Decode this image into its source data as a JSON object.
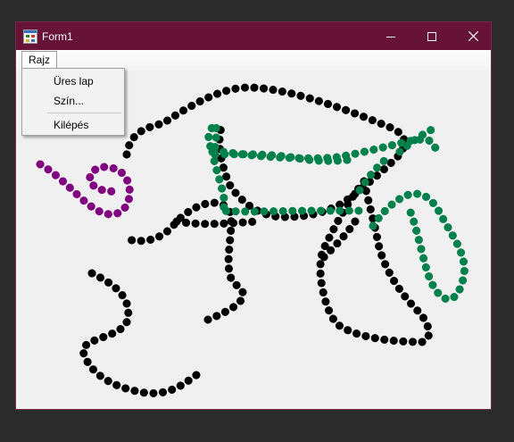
{
  "window": {
    "title": "Form1",
    "titlebar_color": "#661337"
  },
  "menu": {
    "label": "Rajz",
    "items": [
      "Üres lap",
      "Szín...",
      "Kilépés"
    ]
  },
  "icons": {
    "app": "app-form-icon",
    "minimize": "minimize-icon",
    "maximize": "maximize-icon",
    "close": "close-icon"
  },
  "drawing": {
    "colors": {
      "black": "#000000",
      "green": "#00804a",
      "purple": "#800080"
    },
    "stroke_count": 5
  }
}
